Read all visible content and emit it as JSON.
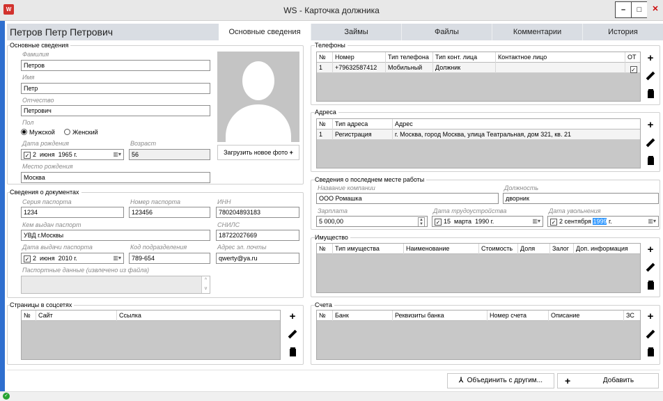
{
  "window": {
    "title": "WS - Карточка должника",
    "app_icon": "W"
  },
  "header": {
    "person_name": "Петров Петр Петрович"
  },
  "tabs": [
    "Основные сведения",
    "Займы",
    "Файлы",
    "Комментарии",
    "История"
  ],
  "basic": {
    "section": "Основные сведения",
    "last_name_label": "Фамилия",
    "last_name": "Петров",
    "first_name_label": "Имя",
    "first_name": "Петр",
    "patronymic_label": "Отчество",
    "patronymic": "Петрович",
    "gender_label": "Пол",
    "gender_male": "Мужской",
    "gender_female": "Женский",
    "birth_label": "Дата рождения",
    "birth_day": "2",
    "birth_month": "июня",
    "birth_year": "1965 г.",
    "age_label": "Возраст",
    "age": "56",
    "birthplace_label": "Место рождения",
    "birthplace": "Москва",
    "upload_photo": "Загрузить новое фото"
  },
  "docs": {
    "section": "Сведения о документах",
    "series_label": "Серия паспорта",
    "series": "1234",
    "number_label": "Номер паспорта",
    "number": "123456",
    "inn_label": "ИНН",
    "inn": "780204893183",
    "issued_by_label": "Кем выдан паспорт",
    "issued_by": "УВД г.Москвы",
    "snils_label": "СНИЛС",
    "snils": "18722027669",
    "issue_date_label": "Дата выдачи паспорта",
    "issue_day": "2",
    "issue_month": "июня",
    "issue_year": "2010 г.",
    "code_label": "Код подразделения",
    "code": "789-654",
    "email_label": "Адрес эл. почты",
    "email": "qwerty@ya.ru",
    "passport_data_label": "Паспортные данные (извлечено из файла)"
  },
  "social": {
    "section": "Страницы в соцсетях",
    "columns": [
      "№",
      "Сайт",
      "Ссылка"
    ]
  },
  "phones": {
    "section": "Телефоны",
    "columns": [
      "№",
      "Номер",
      "Тип телефона",
      "Тип конт. лица",
      "Контактное лицо",
      "ОТ"
    ],
    "rows": [
      [
        "1",
        "+79632587412",
        "Мобильный",
        "Должник",
        "",
        ""
      ]
    ]
  },
  "addresses": {
    "section": "Адреса",
    "columns": [
      "№",
      "Тип адреса",
      "Адрес"
    ],
    "rows": [
      [
        "1",
        "Регистрация",
        "г. Москва, город Москва, улица Театральная, дом 321, кв. 21"
      ]
    ]
  },
  "work": {
    "section": "Сведения о последнем месте работы",
    "company_label": "Название компании",
    "company": "ООО Ромашка",
    "position_label": "Должность",
    "position": "дворник",
    "salary_label": "Зарплата",
    "salary": "5 000,00",
    "hire_label": "Дата трудоустройства",
    "hire_day": "15",
    "hire_month": "марта",
    "hire_year": "1990 г.",
    "fire_label": "Дата увольнения",
    "fire_day": "2",
    "fire_month": "сентября",
    "fire_year_sel": "1999",
    "fire_year_suffix": " г."
  },
  "property": {
    "section": "Имущество",
    "columns": [
      "№",
      "Тип имущества",
      "Наименование",
      "Стоимость",
      "Доля",
      "Залог",
      "Доп. информация"
    ]
  },
  "accounts": {
    "section": "Счета",
    "columns": [
      "№",
      "Банк",
      "Реквизиты банка",
      "Номер счета",
      "Описание",
      "ЗС"
    ]
  },
  "footer": {
    "merge": "Объединить с другим...",
    "add": "Добавить"
  },
  "icons": {
    "merge": "merge-icon",
    "add": "plus-icon",
    "edit": "pencil-icon",
    "delete": "trash-icon",
    "status": "ok-icon"
  }
}
